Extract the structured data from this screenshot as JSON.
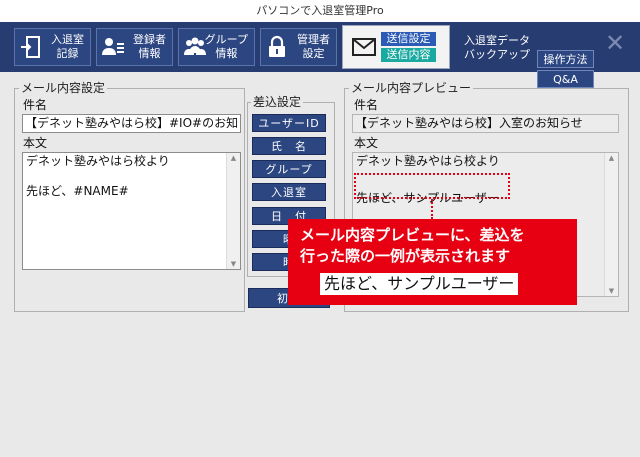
{
  "window": {
    "title": "パソコンで入退室管理Pro"
  },
  "toolbar": {
    "items": [
      {
        "label": "入退室\n記録",
        "icon": "door-exit-icon"
      },
      {
        "label": "登録者\n情報",
        "icon": "user-card-icon"
      },
      {
        "label": "グループ\n情報",
        "icon": "group-icon"
      },
      {
        "label": "管理者\n設定",
        "icon": "lock-icon"
      }
    ],
    "mail": {
      "icon": "envelope-icon",
      "tab_settings": "送信設定",
      "tab_content": "送信内容"
    },
    "backup_label": "入退室データ\nバックアップ",
    "help_label": "操作方法",
    "qa_label": "Q&A",
    "close_icon": "close-icon"
  },
  "mail_settings": {
    "legend": "メール内容設定",
    "subject_label": "件名",
    "subject_value": "【デネット塾みやはら校】#IO#のお知らせ",
    "body_label": "本文",
    "body_lines": [
      "デネット塾みやはら校より",
      "",
      "先ほど、#NAME#"
    ]
  },
  "insert_settings": {
    "legend": "差込設定",
    "buttons": [
      "ユーザーID",
      "氏　名",
      "グループ",
      "入退室",
      "日　付",
      "曜",
      "時"
    ],
    "reset_label": "初期"
  },
  "preview": {
    "legend": "メール内容プレビュー",
    "subject_label": "件名",
    "subject_value": "【デネット塾みやはら校】入室のお知らせ",
    "body_label": "本文",
    "body_lines": [
      "デネット塾みやはら校より",
      "",
      "先ほど、サンプルユーザー"
    ]
  },
  "callout": {
    "line1": "メール内容プレビューに、差込を",
    "line2": "行った際の一例が表示されます",
    "example": "先ほど、サンプルユーザー"
  },
  "colors": {
    "toolbar_bg": "#273c70",
    "button_bg": "#2c4682",
    "tab_active": "#2b5bb5",
    "tab_teal": "#1aa9a0",
    "callout_red": "#e60012"
  }
}
